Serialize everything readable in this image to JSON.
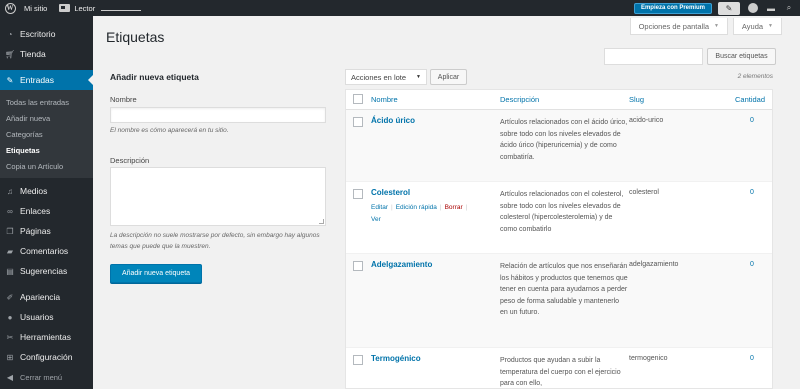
{
  "adminbar": {
    "site_name": "Mi sitio",
    "reader_label": "Lector",
    "premium_button": "Empieza con Premium"
  },
  "sidebar": {
    "items_top": [
      {
        "label": "Escritorio",
        "icon": "dashboard-icon"
      },
      {
        "label": "Tienda",
        "icon": "cart-icon"
      }
    ],
    "current": {
      "label": "Entradas",
      "icon": "pin-icon"
    },
    "submenu": [
      "Todas las entradas",
      "Añadir nueva",
      "Categorías",
      "Etiquetas",
      "Copia un Artículo"
    ],
    "submenu_active": "Etiquetas",
    "items_middle": [
      {
        "label": "Medios",
        "icon": "media-icon"
      },
      {
        "label": "Enlaces",
        "icon": "link-icon"
      },
      {
        "label": "Páginas",
        "icon": "page-icon"
      },
      {
        "label": "Comentarios",
        "icon": "comment-icon"
      },
      {
        "label": "Sugerencias",
        "icon": "suggestion-icon"
      }
    ],
    "items_bottom": [
      {
        "label": "Apariencia",
        "icon": "brush-icon"
      },
      {
        "label": "Usuarios",
        "icon": "users-icon"
      },
      {
        "label": "Herramientas",
        "icon": "wrench-icon"
      },
      {
        "label": "Configuración",
        "icon": "settings-icon"
      }
    ],
    "collapse": "Cerrar menú"
  },
  "header": {
    "screen_options": "Opciones de pantalla",
    "help": "Ayuda",
    "title": "Etiquetas",
    "search_button": "Buscar etiquetas"
  },
  "form": {
    "title": "Añadir nueva etiqueta",
    "name_label": "Nombre",
    "name_hint": "El nombre es cómo aparecerá en tu sitio.",
    "desc_label": "Descripción",
    "desc_hint": "La descripción no suele mostrarse por defecto, sin embargo hay algunos temas que puede que la muestren.",
    "submit": "Añadir nueva etiqueta"
  },
  "bulk": {
    "selected": "Acciones en lote",
    "apply": "Aplicar",
    "count": "2 elementos"
  },
  "table": {
    "headers": {
      "name": "Nombre",
      "description": "Descripción",
      "slug": "Slug",
      "count": "Cantidad"
    },
    "row_actions": {
      "edit": "Editar",
      "quick": "Edición rápida",
      "delete": "Borrar",
      "view": "Ver"
    },
    "rows": [
      {
        "name": "Ácido úrico",
        "description": "Artículos relacionados con el ácido úrico, sobre todo con los niveles elevados de ácido úrico (hiperuricemia) y de como combatiría.",
        "slug": "acido-urico",
        "count": "0"
      },
      {
        "name": "Colesterol",
        "description": "Artículos relacionados con el colesterol, sobre todo con los niveles elevados de colesterol (hipercolesterolemia) y de como combatirlo",
        "slug": "colesterol",
        "count": "0"
      },
      {
        "name": "Adelgazamiento",
        "description": "Relación de artículos que nos enseñarán los hábitos y productos que tenemos que tener en cuenta para ayudarnos a perder peso de forma saludable y mantenerlo en un futuro.",
        "slug": "adelgazamiento",
        "count": "0"
      },
      {
        "name": "Termogénico",
        "description": "Productos que ayudan a subir la temperatura del cuerpo con el ejercicio para con ello,",
        "slug": "termogenico",
        "count": "0"
      }
    ]
  }
}
